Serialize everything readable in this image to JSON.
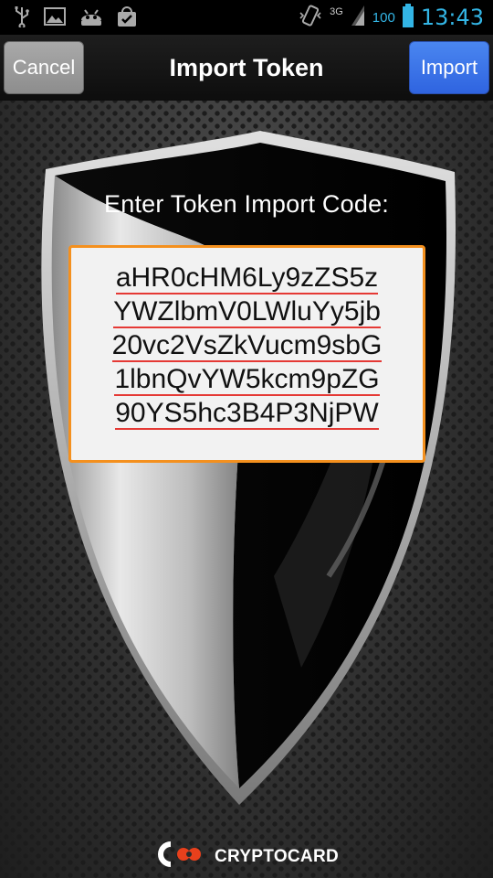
{
  "status_bar": {
    "time": "13:43",
    "battery": "100",
    "network": "3G",
    "icons": [
      "usb-icon",
      "image-icon",
      "android-icon",
      "shopping-bag-icon",
      "vibrate-icon",
      "signal-icon",
      "battery-icon"
    ]
  },
  "header": {
    "title": "Import Token",
    "cancel_label": "Cancel",
    "import_label": "Import"
  },
  "main": {
    "prompt": "Enter Token Import Code:",
    "code_lines": [
      "aHR0cHM6Ly9zZS5z",
      "YWZlbmV0LWluYy5jb",
      "20vc2VsZkVucm9sbG",
      "1lbnQvYW5kcm9pZG",
      "90YS5hc3B4P3NjPW"
    ]
  },
  "brand": {
    "name": "CRYPTOCARD"
  },
  "colors": {
    "accent_blue": "#33b5e5",
    "import_button": "#3a72ea",
    "field_border": "#f4901e",
    "spell_underline": "#e53935"
  }
}
